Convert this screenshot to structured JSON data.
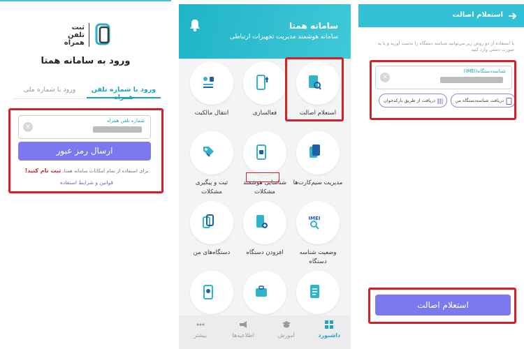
{
  "login": {
    "logo_text": [
      "ثبت",
      "تلفن",
      "همراه"
    ],
    "title": "ورود به سامانه همتا",
    "tabs": [
      {
        "label": "ورود با شماره تلفن همراه",
        "active": true
      },
      {
        "label": "ورود با شماره ملی",
        "active": false
      }
    ],
    "phone_field_label": "شماره تلفن همراه",
    "submit_label": "ارسال رمز عبور",
    "note_text": "برای استفاده از تمام امکانات سامانه همتا،",
    "signup_link": "ثبت نام کنید!",
    "terms_link": "قوانین و شرایط استفاده"
  },
  "dashboard": {
    "title": "سامانه همتا",
    "subtitle": "سامانه هوشمند مدیریت تجهیزات ارتباطی",
    "tiles": [
      {
        "label": "استعلام اصالت",
        "icon": "search-doc-icon"
      },
      {
        "label": "فعالسازی",
        "icon": "phone-activate-icon"
      },
      {
        "label": "انتقال مالکیت",
        "icon": "transfer-icon"
      },
      {
        "label": "مدیریت سیم‌کارت‌ها",
        "icon": "sim-card-icon"
      },
      {
        "label": "شناسایی هوشمند مشکلات",
        "icon": "smart-detect-icon"
      },
      {
        "label": "ثبت و پیگیری مشکلات",
        "icon": "tag-icon"
      },
      {
        "label": "وضعیت شناسه دستگاه",
        "icon": "imei-search-icon"
      },
      {
        "label": "افزودن دستگاه",
        "icon": "add-device-icon"
      },
      {
        "label": "دستگاه‌های من",
        "icon": "my-devices-icon"
      },
      {
        "label": "",
        "icon": "document-icon"
      },
      {
        "label": "",
        "icon": "briefcase-icon"
      },
      {
        "label": "",
        "icon": "clipboard-icon"
      }
    ],
    "imei_badge": "IMEI",
    "nav": [
      {
        "label": "داشبورد",
        "icon": "grid-icon",
        "active": true
      },
      {
        "label": "آموزش",
        "icon": "graduation-icon",
        "active": false
      },
      {
        "label": "اطلاعیه‌ها",
        "icon": "megaphone-icon",
        "active": false
      },
      {
        "label": "بیشتر",
        "icon": "more-icon",
        "active": false
      }
    ]
  },
  "inquiry": {
    "title": "استعلام اصالت",
    "description": "با استفاده از دو روش زیر می‌توانید شناسه دستگاه را بدست آورید و یا به صورت دستی وارد کنید",
    "field_label": "شناسه‌دستگاه(IMEI)",
    "chip_my_device": "دریافت شناسه‌دستگاه من",
    "chip_barcode": "دریافت از طریق بارکدخوان",
    "submit_label": "استعلام اصالت"
  },
  "colors": {
    "teal": "#32c0d6",
    "accent_purple": "#7c78ee",
    "highlight_red": "#d61f26",
    "tab_active": "#1ba5bf"
  }
}
